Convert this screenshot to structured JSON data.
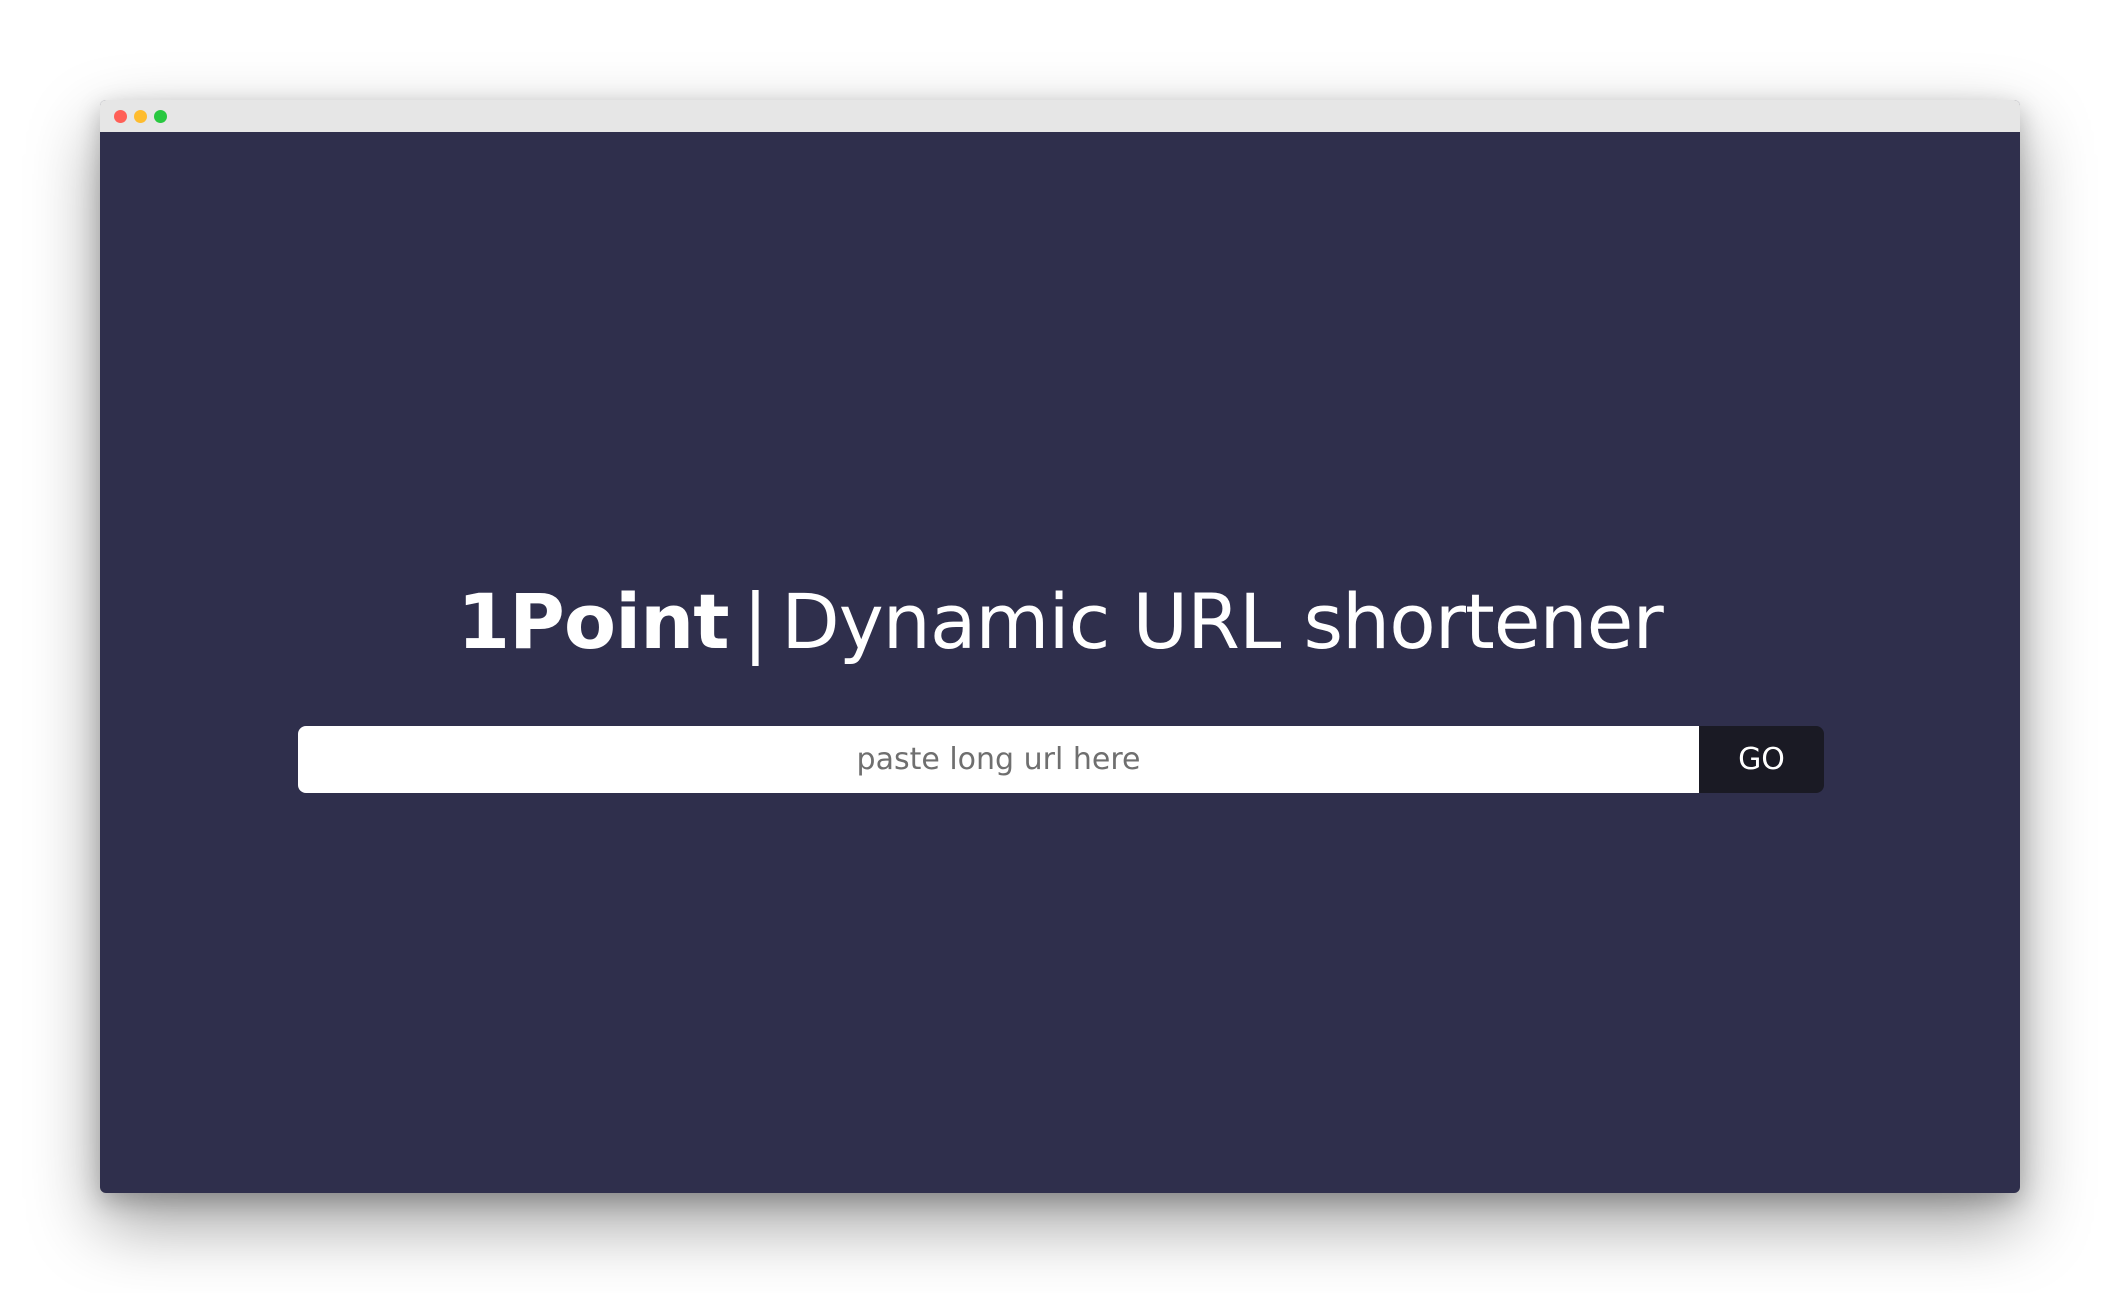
{
  "window": {
    "controls": [
      {
        "name": "close",
        "color": "#ff5f57"
      },
      {
        "name": "minimize",
        "color": "#febc2e"
      },
      {
        "name": "maximize",
        "color": "#28c840"
      }
    ],
    "background": "#2f2f4c",
    "titlebar_color": "#e6e6e6"
  },
  "header": {
    "brand": "1Point",
    "separator": "|",
    "tagline": "Dynamic URL shortener"
  },
  "form": {
    "url_input": {
      "value": "",
      "placeholder": "paste long url here"
    },
    "go_label": "GO",
    "go_button_color": "#1a1a24"
  }
}
